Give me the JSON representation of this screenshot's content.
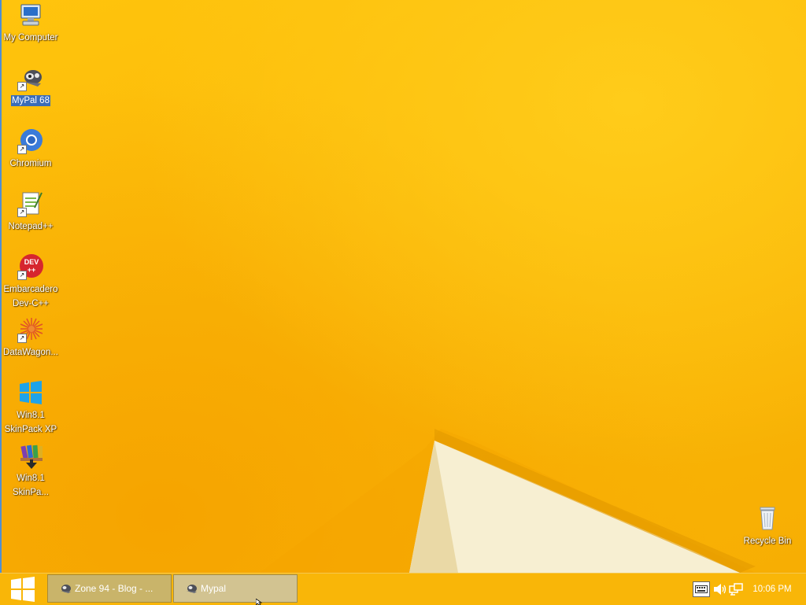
{
  "desktop": {
    "icons": [
      {
        "label": "My Computer"
      },
      {
        "label": "MyPal 68"
      },
      {
        "label": "Chromium"
      },
      {
        "label": "Notepad++"
      },
      {
        "label": "Embarcadero Dev-C++",
        "line1": "Embarcadero",
        "line2": "Dev-C++"
      },
      {
        "label": "DataWagon..."
      },
      {
        "label": "Win8.1 SkinPack XP",
        "line1": "Win8.1",
        "line2": "SkinPack XP"
      },
      {
        "label": "Win8.1 SkinPa...",
        "line1": "Win8.1",
        "line2": "SkinPa..."
      },
      {
        "label": "Recycle Bin"
      }
    ],
    "selected_icon": "MyPal 68",
    "icon_semantics": [
      "computer-icon",
      "mypal-icon",
      "chromium-icon",
      "notepadpp-icon",
      "devcpp-icon",
      "datawagon-icon",
      "windows-logo-icon",
      "winrar-icon",
      "recycle-bin-icon"
    ]
  },
  "taskbar": {
    "start_icon": "windows-logo-icon",
    "tasks": [
      {
        "label": "Zone 94 - Blog - ...",
        "icon": "mypal-icon"
      },
      {
        "label": "Mypal",
        "icon": "mypal-icon",
        "active": true
      }
    ],
    "tray_icons": [
      "keyboard-icon",
      "volume-icon",
      "network-icon"
    ],
    "clock": "10:06 PM"
  },
  "colors": {
    "wallpaper": "#f9b705",
    "taskbar": "#f9b608",
    "selection": "#3a6cb8",
    "label_text": "#ffffff"
  }
}
